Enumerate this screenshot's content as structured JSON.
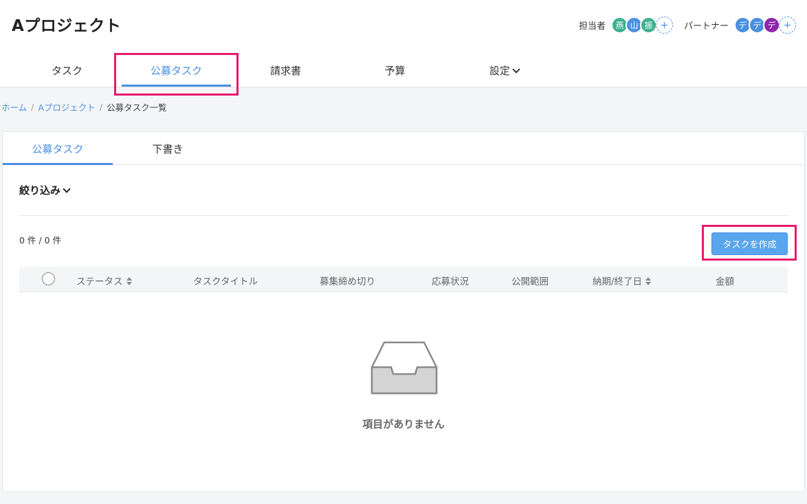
{
  "header": {
    "project_title": "Aプロジェクト",
    "assignee_label": "担当者",
    "assignees": [
      {
        "initial": "燕",
        "color": "#3bb08f"
      },
      {
        "initial": "山",
        "color": "#4a8fe0"
      },
      {
        "initial": "振",
        "color": "#3bb08f"
      }
    ],
    "partner_label": "パートナー",
    "partners": [
      {
        "initial": "デ",
        "color": "#4a8fe0"
      },
      {
        "initial": "デ",
        "color": "#4a8fe0"
      },
      {
        "initial": "デ",
        "color": "#8e24aa"
      }
    ],
    "add_symbol": "+"
  },
  "main_tabs": [
    {
      "label": "タスク"
    },
    {
      "label": "公募タスク"
    },
    {
      "label": "請求書"
    },
    {
      "label": "予算"
    },
    {
      "label": "設定"
    }
  ],
  "breadcrumb": {
    "home": "ホーム",
    "project": "Aプロジェクト",
    "current": "公募タスク一覧",
    "sep": "/"
  },
  "sub_tabs": [
    {
      "label": "公募タスク"
    },
    {
      "label": "下書き"
    }
  ],
  "filter_label": "絞り込み",
  "count_text": "0 件 / 0 件",
  "create_button": "タスクを作成",
  "table": {
    "columns": [
      "ステータス",
      "タスクタイトル",
      "募集締め切り",
      "応募状況",
      "公開範囲",
      "納期/終了日",
      "金額"
    ]
  },
  "empty_text": "項目がありません",
  "colors": {
    "accent": "#4a90e2",
    "highlight": "#e8196b"
  }
}
